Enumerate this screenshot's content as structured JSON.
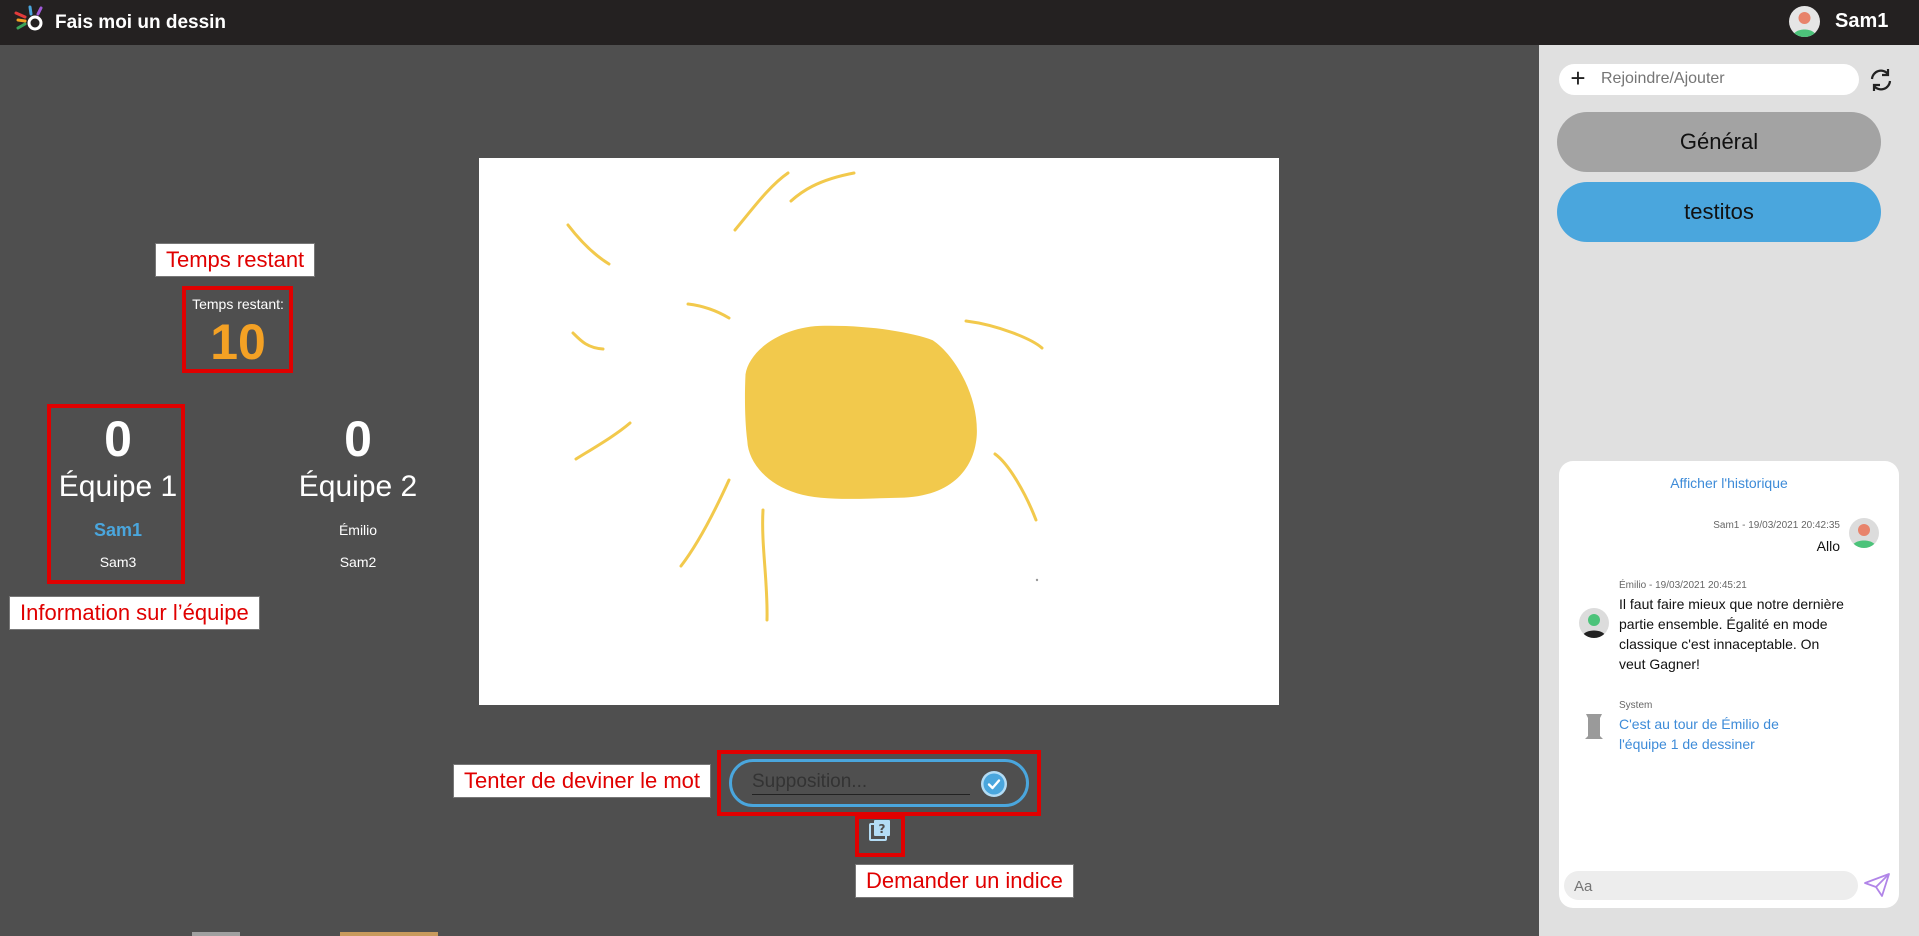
{
  "app": {
    "title": "Fais moi un dessin"
  },
  "user": {
    "name": "Sam1"
  },
  "channels": {
    "join_placeholder": "Rejoindre/Ajouter",
    "items": [
      {
        "label": "Général"
      },
      {
        "label": "testitos"
      }
    ]
  },
  "chat": {
    "history_link": "Afficher l'historique",
    "messages": [
      {
        "meta": "Sam1 - 19/03/2021 20:42:35",
        "text": "Allo"
      },
      {
        "meta": "Émilio - 19/03/2021 20:45:21",
        "text": "Il faut faire mieux que notre dernière partie ensemble. Égalité en mode classique c'est innaceptable. On veut Gagner!"
      },
      {
        "meta": "System",
        "text": "C'est au tour de Émilio de l'équipe 1 de dessiner"
      }
    ],
    "input_placeholder": "Aa"
  },
  "timer": {
    "label": "Temps restant:",
    "value": "10"
  },
  "teams": [
    {
      "score": "0",
      "name": "Équipe 1",
      "players": [
        "Sam1",
        "Sam3"
      ]
    },
    {
      "score": "0",
      "name": "Équipe 2",
      "players": [
        "Émilio",
        "Sam2"
      ]
    }
  ],
  "guess": {
    "placeholder": "Supposition..."
  },
  "annotations": {
    "timer": "Temps restant",
    "team": "Information sur l’équipe",
    "guess": "Tenter de deviner le mot",
    "hint": "Demander un indice"
  },
  "colors": {
    "topbar": "#242121",
    "background": "#4f4f4f",
    "accent_blue": "#4aa6dd",
    "timer_orange": "#f4a124",
    "annotation_red": "#e00000",
    "sun_yellow": "#f2c94c"
  },
  "icons": {
    "logo": "logo-icon",
    "join": "plus-icon",
    "refresh": "refresh-icon",
    "send": "send-icon",
    "guess_submit": "check-icon",
    "hint": "hint-icon"
  }
}
